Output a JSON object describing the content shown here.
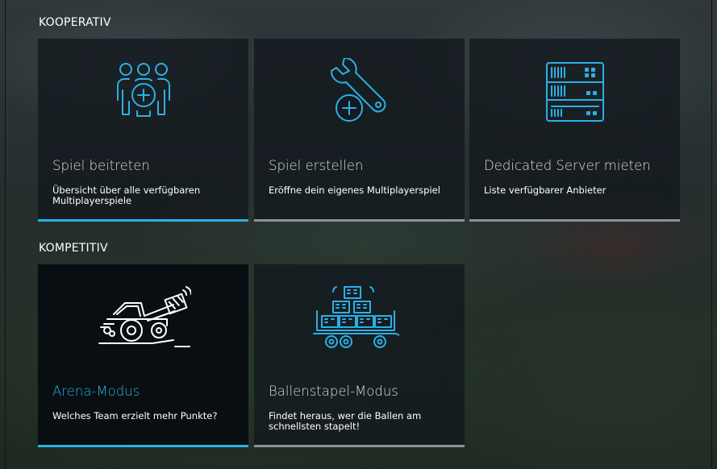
{
  "sections": {
    "kooperativ": {
      "title": "KOOPERATIV",
      "cards": [
        {
          "title": "Spiel beitreten",
          "description": "Übersicht über alle verfügbaren Multiplayerspiele",
          "icon": "join-game-icon",
          "active": true
        },
        {
          "title": "Spiel erstellen",
          "description": "Eröffne dein eigenes Multiplayerspiel",
          "icon": "create-game-icon",
          "active": false
        },
        {
          "title": "Dedicated Server mieten",
          "description": "Liste verfügbarer Anbieter",
          "icon": "server-icon",
          "active": false
        }
      ]
    },
    "kompetitiv": {
      "title": "KOMPETITIV",
      "cards": [
        {
          "title": "Arena-Modus",
          "description": "Welches Team erzielt mehr Punkte?",
          "icon": "tractor-arena-icon",
          "active": true,
          "selected": true
        },
        {
          "title": "Ballenstapel-Modus",
          "description": "Findet heraus, wer die Ballen am schnellsten stapelt!",
          "icon": "bale-stacking-icon",
          "active": false
        }
      ]
    }
  },
  "colors": {
    "accent": "#2ab0e6",
    "card_bg": "#141a1e",
    "inactive_bar": "#8c9296",
    "text": "#ffffff"
  }
}
